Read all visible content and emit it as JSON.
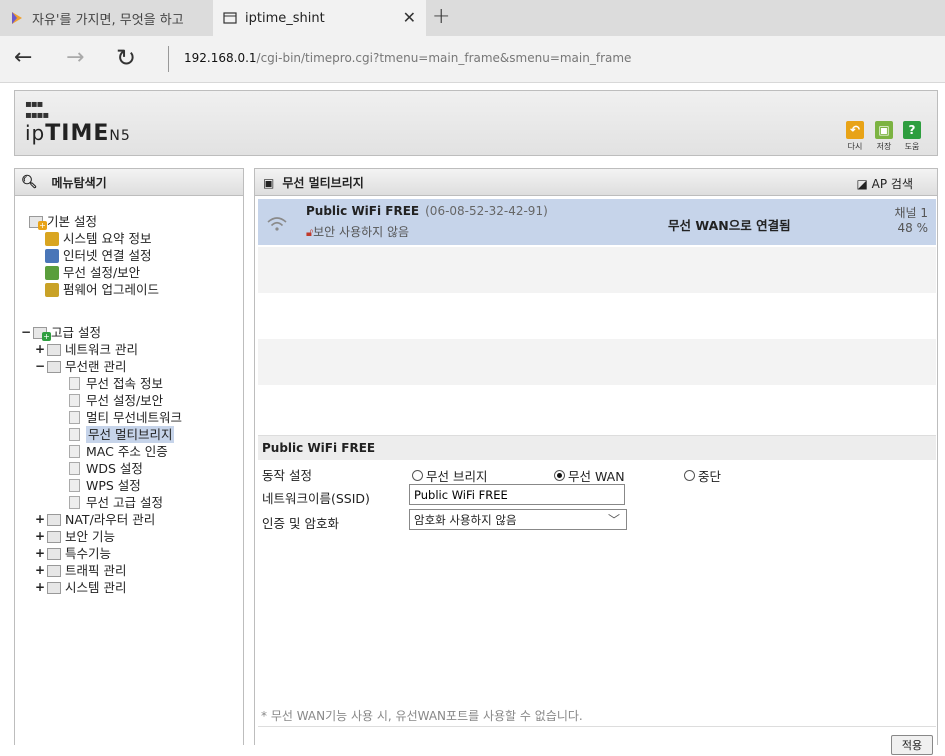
{
  "browser": {
    "tabs": [
      {
        "title": "자유'를 가지면, 무엇을 하고",
        "active": false
      },
      {
        "title": "iptime_shint",
        "active": true
      }
    ],
    "url_host": "192.168.0.1",
    "url_path": "/cgi-bin/timepro.cgi?tmenu=main_frame&smenu=main_frame"
  },
  "header": {
    "logo_prefix": "ip",
    "logo_bold": "TIME",
    "logo_model": "N5",
    "buttons": [
      {
        "label": "다시",
        "icon": "undo-icon",
        "color": "#e8a317"
      },
      {
        "label": "저장",
        "icon": "save-icon",
        "color": "#7cb342"
      },
      {
        "label": "도움",
        "icon": "help-icon",
        "color": "#2e9e3f"
      }
    ]
  },
  "sidebar": {
    "title": "메뉴탐색기",
    "basic": {
      "label": "기본 설정",
      "items": [
        "시스템 요약 정보",
        "인터넷 연결 설정",
        "무선 설정/보안",
        "펌웨어 업그레이드"
      ]
    },
    "advanced": {
      "label": "고급 설정",
      "network": "네트워크 관리",
      "wlan": {
        "label": "무선랜 관리",
        "items": [
          "무선 접속 정보",
          "무선 설정/보안",
          "멀티 무선네트워크",
          "무선 멀티브리지",
          "MAC 주소 인증",
          "WDS 설정",
          "WPS 설정",
          "무선 고급 설정"
        ]
      },
      "others": [
        "NAT/라우터 관리",
        "보안 기능",
        "특수기능",
        "트래픽 관리",
        "시스템 관리"
      ]
    }
  },
  "main": {
    "title": "무선 멀티브리지",
    "ap_search": "AP 검색",
    "ap": {
      "name": "Public WiFi FREE",
      "mac": "(06-08-52-32-42-91)",
      "security": "보안 사용하지 않음",
      "status": "무선 WAN으로 연결됨",
      "channel": "채널 1",
      "signal": "48 %"
    },
    "form": {
      "section_title": "Public WiFi FREE",
      "mode_label": "동작 설정",
      "mode_options": [
        "무선 브리지",
        "무선 WAN",
        "중단"
      ],
      "mode_selected": "무선 WAN",
      "ssid_label": "네트워크이름(SSID)",
      "ssid_value": "Public WiFi FREE",
      "auth_label": "인증 및 암호화",
      "auth_value": "암호화 사용하지 않음"
    },
    "footnote": "* 무선 WAN기능 사용 시, 유선WAN포트를 사용할 수 없습니다.",
    "apply": "적용"
  }
}
